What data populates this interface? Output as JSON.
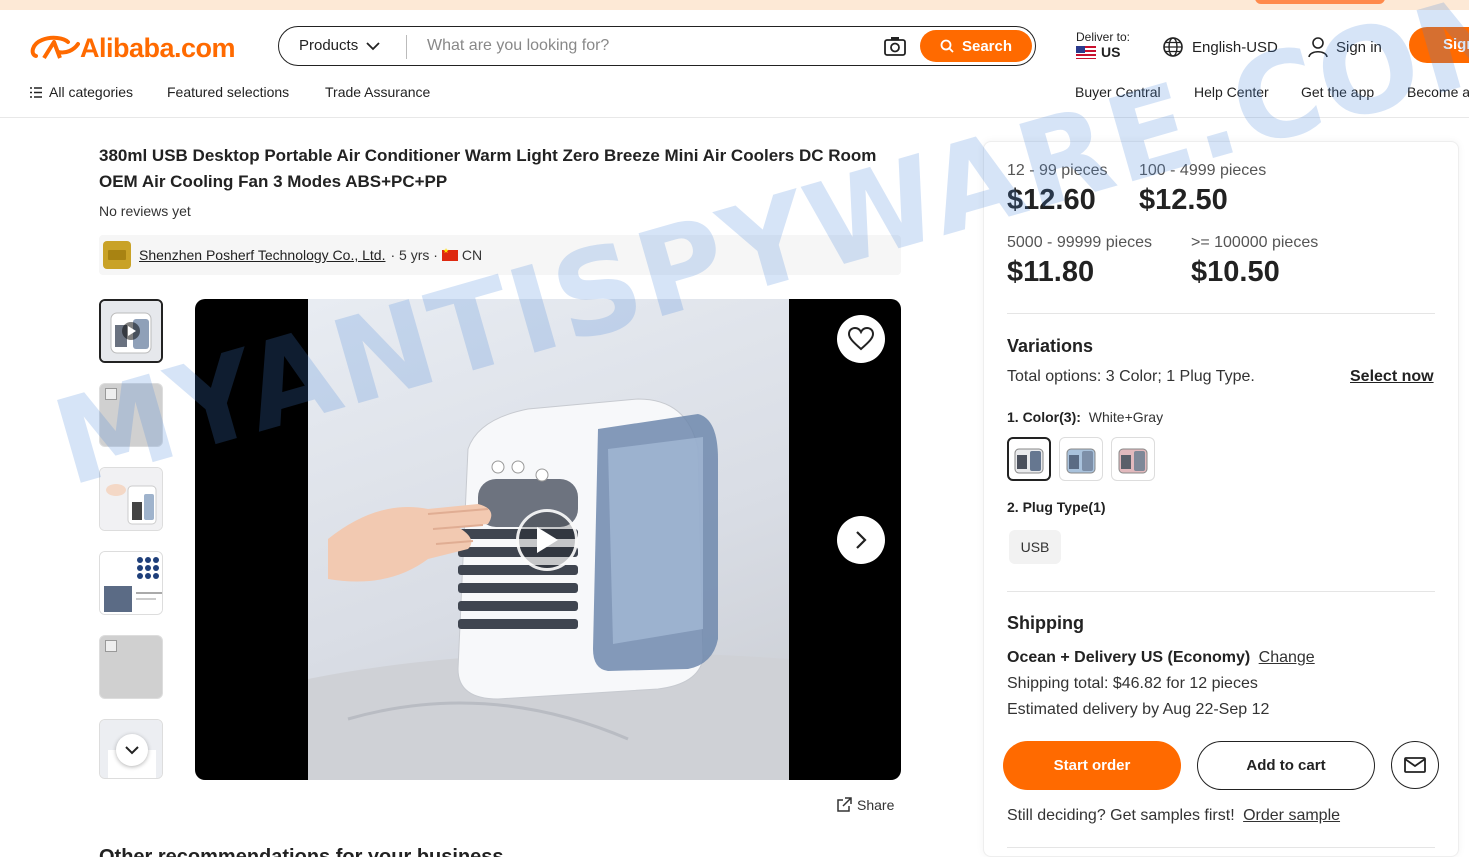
{
  "header": {
    "logo_text": "Alibaba.com",
    "search": {
      "category": "Products",
      "placeholder": "What are you looking for?",
      "button_label": "Search"
    },
    "deliver": {
      "label": "Deliver to:",
      "country": "US"
    },
    "language": "English-USD",
    "sign_in": "Sign in",
    "sign_up": "Sign up"
  },
  "subnav": {
    "left": [
      "All categories",
      "Featured selections",
      "Trade Assurance"
    ],
    "right": [
      "Buyer Central",
      "Help Center",
      "Get the app",
      "Become a supplier"
    ]
  },
  "product": {
    "title": "380ml USB Desktop Portable Air Conditioner Warm Light Zero Breeze Mini Air Coolers DC Room OEM Air Cooling Fan 3 Modes ABS+PC+PP",
    "reviews": "No reviews yet",
    "supplier": {
      "name": "Shenzhen Posherf Technology Co., Ltd.",
      "years": "· 5 yrs ·",
      "country": "CN"
    },
    "share_label": "Share"
  },
  "pricing": {
    "tiers": [
      {
        "qty": "12 - 99 pieces",
        "price": "$12.60"
      },
      {
        "qty": "100 - 4999 pieces",
        "price": "$12.50"
      },
      {
        "qty": "5000 - 99999 pieces",
        "price": "$11.80"
      },
      {
        "qty": ">= 100000 pieces",
        "price": "$10.50"
      }
    ]
  },
  "variations": {
    "heading": "Variations",
    "total_label": "Total options:",
    "total_value": "3 Color; 1 Plug Type.",
    "select_now": "Select now",
    "color_label": "1. Color(3):",
    "color_selected": "White+Gray",
    "plug_label": "2. Plug Type(1)",
    "plug_option": "USB"
  },
  "shipping": {
    "heading": "Shipping",
    "method": "Ocean + Delivery US (Economy)",
    "change": "Change",
    "total": "Shipping total: $46.82 for 12 pieces",
    "estimate": "Estimated delivery by Aug 22-Sep 12"
  },
  "actions": {
    "start_order": "Start order",
    "add_to_cart": "Add to cart",
    "samples_text": "Still deciding? Get samples first!",
    "order_sample": "Order sample"
  },
  "recommendations_heading": "Other recommendations for your business",
  "watermark": "MYANTISPYWARE.COM",
  "colors": {
    "brand": "#ff6a00",
    "text": "#222222"
  }
}
